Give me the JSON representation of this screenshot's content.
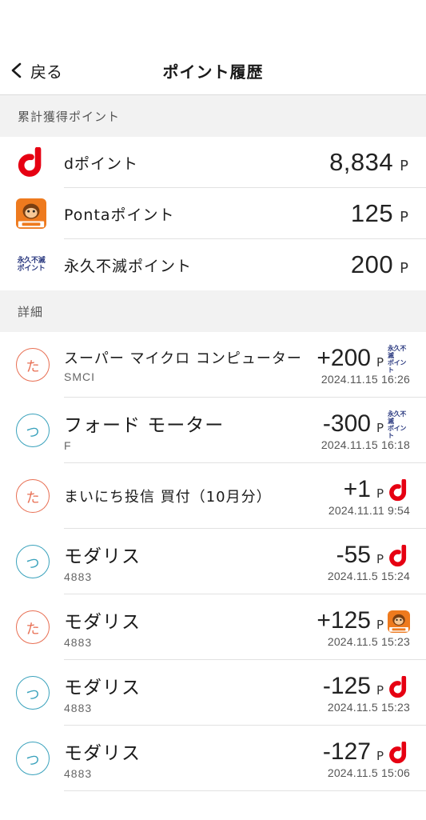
{
  "nav": {
    "back_label": "戻る",
    "title": "ポイント履歴"
  },
  "totals": {
    "header": "累計獲得ポイント",
    "items": [
      {
        "logo": "d-point-logo",
        "name": "dポイント",
        "amount": "8,834",
        "unit": "P"
      },
      {
        "logo": "ponta-logo",
        "name": "Pontaポイント",
        "amount": "125",
        "unit": "P"
      },
      {
        "logo": "eternal-point-logo",
        "logo_text": [
          "永久不滅",
          "ポイント"
        ],
        "name": "永久不滅ポイント",
        "amount": "200",
        "unit": "P"
      }
    ]
  },
  "details": {
    "header": "詳細",
    "items": [
      {
        "badge": "た",
        "type": "buy",
        "title": "スーパー マイクロ コンピューター",
        "sub": "SMCI",
        "amount": "+200",
        "unit": "P",
        "logo": "eternal-point-logo",
        "timestamp": "2024.11.15 16:26"
      },
      {
        "badge": "つ",
        "type": "use",
        "title": "フォード モーター",
        "sub": "F",
        "amount": "-300",
        "unit": "P",
        "logo": "eternal-point-logo",
        "timestamp": "2024.11.15 16:18"
      },
      {
        "badge": "た",
        "type": "buy",
        "title": "まいにち投信 買付（10月分）",
        "sub": "",
        "amount": "+1",
        "unit": "P",
        "logo": "d-point-logo",
        "timestamp": "2024.11.11 9:54"
      },
      {
        "badge": "つ",
        "type": "use",
        "title": "モダリス",
        "sub": "4883",
        "amount": "-55",
        "unit": "P",
        "logo": "d-point-logo",
        "timestamp": "2024.11.5 15:24"
      },
      {
        "badge": "た",
        "type": "buy",
        "title": "モダリス",
        "sub": "4883",
        "amount": "+125",
        "unit": "P",
        "logo": "ponta-logo",
        "timestamp": "2024.11.5 15:23"
      },
      {
        "badge": "つ",
        "type": "use",
        "title": "モダリス",
        "sub": "4883",
        "amount": "-125",
        "unit": "P",
        "logo": "d-point-logo",
        "timestamp": "2024.11.5 15:23"
      },
      {
        "badge": "つ",
        "type": "use",
        "title": "モダリス",
        "sub": "4883",
        "amount": "-127",
        "unit": "P",
        "logo": "d-point-logo",
        "timestamp": "2024.11.5 15:06"
      }
    ]
  },
  "colors": {
    "d_red": "#e60012",
    "ponta_orange": "#ee7a1e",
    "buy": "#e86f53",
    "use": "#3aa2bc",
    "eternal_navy": "#2b3a80"
  }
}
